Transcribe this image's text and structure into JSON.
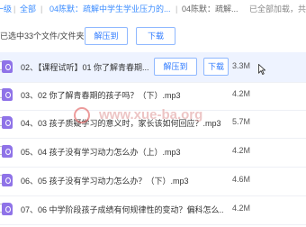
{
  "breadcrumb": {
    "items": [
      "一级",
      "全部",
      "04陈默：疏解中学生学业压力的...",
      "04陈默：疏解..."
    ],
    "separator": "|",
    "status": "已全部加载，共"
  },
  "toolbar": {
    "selection_summary": "已选中33个文件/文件夹",
    "unzip_label": "解压到",
    "download_label": "下载"
  },
  "files": [
    {
      "name": "02、【课程试听】01 你了解青春期...",
      "size": "3.3M"
    },
    {
      "name": "03、02 你了解青春期的孩子吗？（下）.mp3",
      "size": "4.2M"
    },
    {
      "name": "04、03 孩子质疑学习的意义时，家长该如何回应？.mp3",
      "size": "5.7M"
    },
    {
      "name": "05、04 孩子没有学习动力怎么办（上）.mp3",
      "size": "4.2M"
    },
    {
      "name": "06、05 孩子没有学习动力怎么办？（下）.mp3",
      "size": "4.6M"
    },
    {
      "name": "07、06 中学阶段孩子成绩有何规律性的变动？偏科怎么...",
      "size": "4.2M"
    }
  ],
  "row_actions": {
    "unzip_label": "解压到",
    "download_label": "下载"
  },
  "watermark": {
    "text": "www.xue-ba.org"
  },
  "colors": {
    "link": "#3b8cff",
    "hover_row": "#eef3ff",
    "file_icon": "#8f73e8",
    "watermark": "#e2a0a0"
  }
}
